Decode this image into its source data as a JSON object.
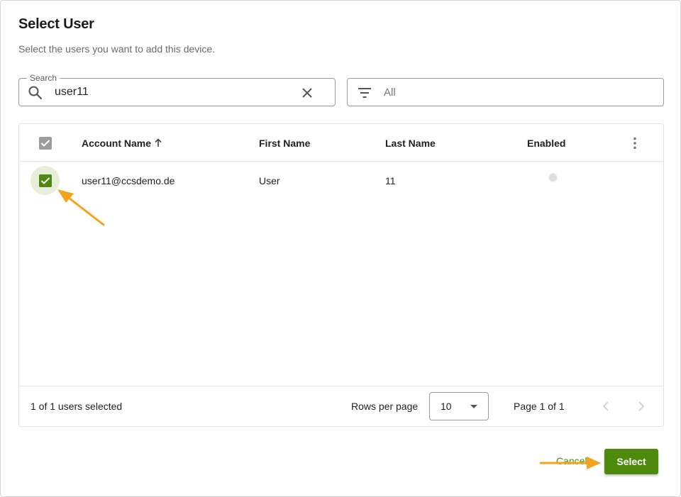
{
  "dialog": {
    "title": "Select User",
    "subtitle": "Select the users you want to add this device."
  },
  "search": {
    "label": "Search",
    "value": "user11",
    "icon": "search-icon",
    "clear_icon": "close-icon"
  },
  "filter": {
    "value": "All",
    "icon": "filter-icon"
  },
  "table": {
    "columns": {
      "account_name": "Account Name",
      "first_name": "First Name",
      "last_name": "Last Name",
      "enabled": "Enabled"
    },
    "sort": {
      "column": "account_name",
      "direction": "ascending",
      "icon": "arrow-up-icon"
    },
    "header_checkbox_state": "checked",
    "rows": [
      {
        "selected": true,
        "account_name": "user11@ccsdemo.de",
        "first_name": "User",
        "last_name": "11",
        "enabled": false
      }
    ]
  },
  "footer": {
    "selected_text": "1 of 1 users selected",
    "rows_per_page_label": "Rows per page",
    "rows_per_page_value": "10",
    "page_info": "Page 1 of 1"
  },
  "actions": {
    "cancel_label": "Cancel",
    "select_label": "Select"
  },
  "colors": {
    "accent": "#4e8b0d",
    "annotation_arrow": "#f5a21c"
  }
}
